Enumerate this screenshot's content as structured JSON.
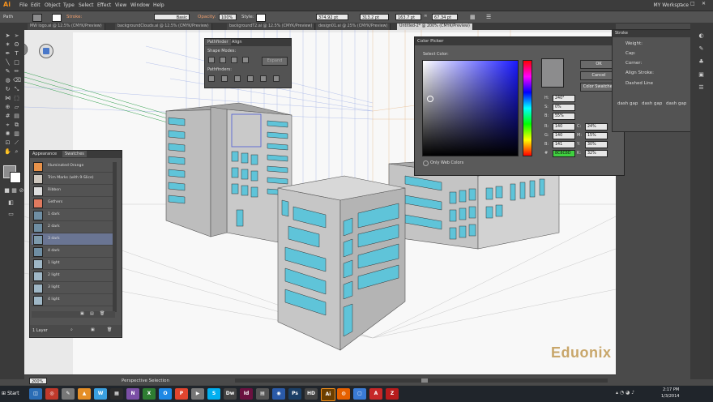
{
  "app": {
    "logo": "Ai",
    "workspace": "MY Workspace"
  },
  "menu": [
    "File",
    "Edit",
    "Object",
    "Type",
    "Select",
    "Effect",
    "View",
    "Window",
    "Help"
  ],
  "control": {
    "object_type": "Path",
    "stroke_label": "Stroke:",
    "basic": "Basic",
    "opacity_label": "Opacity:",
    "opacity": "100%",
    "style_label": "Style:",
    "x": "374.92 pt",
    "y": "313.2 pt",
    "w": "163.7 pt",
    "h": "67.34 pt"
  },
  "tabs": [
    "MW logo.ai @ 12.5% (CMYK/Preview)",
    "backgroundClouds.ai @ 12.5% (CMYK/Preview)",
    "backgroundT2.ai @ 12.5% (CMYK/Preview)",
    "design01.ai @ 25% (CMYK/Preview)",
    "Untitled-2* @ 200% (CMYK/Preview)"
  ],
  "swatches_panel": {
    "tabs": [
      "Appearance",
      "Swatches"
    ],
    "items": [
      {
        "name": "Illuminated Orange",
        "color": "#e8924a"
      },
      {
        "name": "Trim Marks (with 9-Slice)",
        "color": "#cfc8bf"
      },
      {
        "name": "Ribbon",
        "color": "#dddddd"
      },
      {
        "name": "Gethers",
        "color": "#e07a5f"
      },
      {
        "name": "1 dark",
        "color": "#6f8ea3"
      },
      {
        "name": "2 dark",
        "color": "#6f8ea3"
      },
      {
        "name": "3 dark",
        "color": "#7d9aac"
      },
      {
        "name": "4 dark",
        "color": "#6f8ea3"
      },
      {
        "name": "1 light",
        "color": "#9fb7c6"
      },
      {
        "name": "2 light",
        "color": "#9fb7c6"
      },
      {
        "name": "3 light",
        "color": "#9fb7c6"
      },
      {
        "name": "4 light",
        "color": "#9fb7c6"
      }
    ],
    "selected": 6,
    "layers": "1 Layer"
  },
  "pathfinder": {
    "tabs": [
      "Pathfinder",
      "Align"
    ],
    "shape_modes": "Shape Modes:",
    "expand": "Expand",
    "pathfinders": "Pathfinders:"
  },
  "color_picker": {
    "title": "Color Picker",
    "select_color": "Select Color:",
    "ok": "OK",
    "cancel": "Cancel",
    "swatches_btn": "Color Swatches",
    "only_web": "Only Web Colors",
    "hsb": [
      {
        "k": "H:",
        "v": "240°"
      },
      {
        "k": "S:",
        "v": "0%"
      },
      {
        "k": "B:",
        "v": "55%"
      }
    ],
    "rgb": [
      {
        "k": "R:",
        "v": "140"
      },
      {
        "k": "G:",
        "v": "140"
      },
      {
        "k": "B:",
        "v": "141"
      }
    ],
    "cmyk": [
      {
        "k": "C:",
        "v": "24%"
      },
      {
        "k": "M:",
        "v": "15%"
      },
      {
        "k": "Y:",
        "v": "30%"
      },
      {
        "k": "K:",
        "v": "32%"
      }
    ],
    "hex": {
      "k": "#",
      "v": "8C8C8D"
    },
    "swatch_color": "#8c8c8d"
  },
  "stroke_panel": {
    "title": "Stroke",
    "weight_label": "Weight:",
    "cap": "Cap:",
    "corner": "Corner:",
    "align": "Align Stroke:",
    "dashed": "Dashed Line",
    "dash_labels": [
      "dash",
      "gap",
      "dash",
      "gap",
      "dash",
      "gap"
    ]
  },
  "status": {
    "zoom": "200%",
    "tool": "Perspective Selection"
  },
  "watermark": {
    "text": "Eduonix"
  },
  "taskbar": {
    "start": "Start",
    "time": "2:17 PM",
    "date": "1/3/2014",
    "apps": [
      {
        "name": "Ai",
        "color": "#2d1600"
      },
      {
        "name": "Dw",
        "color": "#1f3a14"
      },
      {
        "name": "Id",
        "color": "#44001f"
      },
      {
        "name": "Ps",
        "color": "#001d33"
      },
      {
        "name": "HD",
        "color": "#444"
      },
      {
        "name": "Ai",
        "color": "#4b2900"
      }
    ]
  }
}
